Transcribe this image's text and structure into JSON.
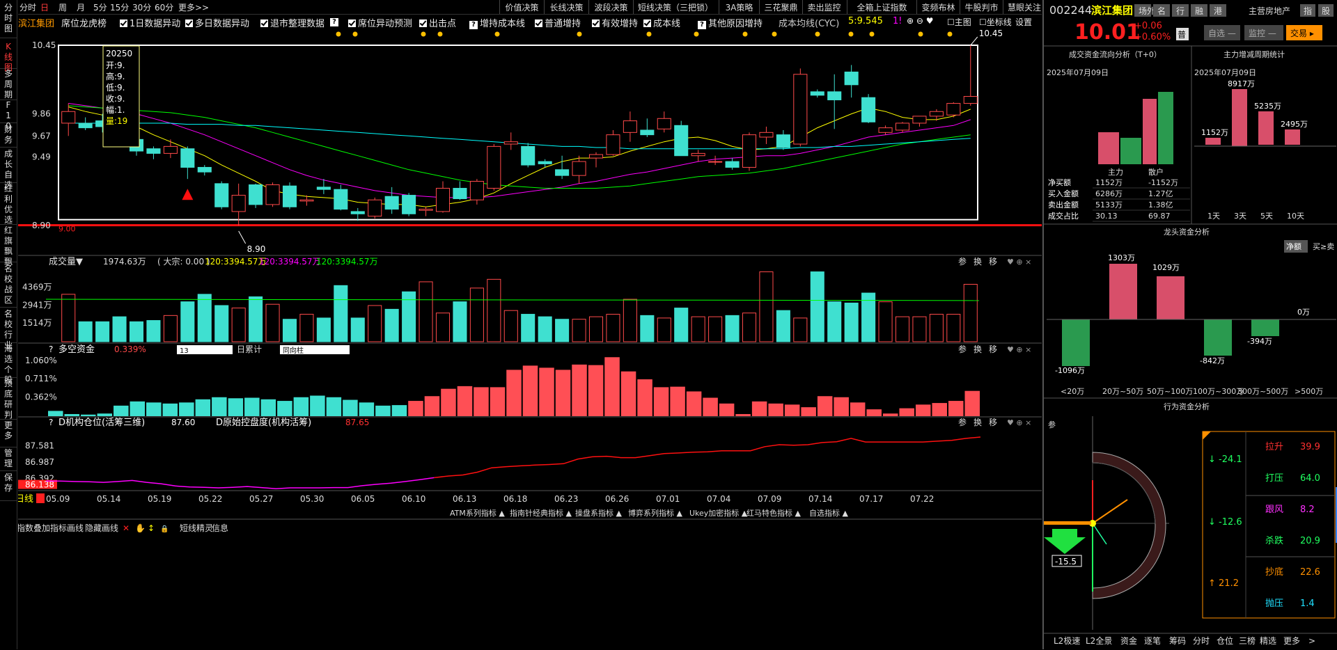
{
  "left_nav": [
    "分时图",
    "K线图",
    "多周期",
    "F10",
    "财务",
    "成长自选",
    "红利优选",
    "红旗飘飘",
    "名校战区",
    "名校行业",
    "海选个股",
    "顶底研判",
    "更多",
    "管理",
    "保存"
  ],
  "periods": [
    "分时",
    "日",
    "周",
    "月",
    "5分",
    "15分",
    "30分",
    "60分",
    "更多>>"
  ],
  "top_right_tabs": [
    "价值决策",
    "长线决策",
    "波段决策",
    "短线决策（三把锁）",
    "3A策略",
    "三花聚鼎",
    "卖出监控",
    "全箱上证指数",
    "变频布林",
    "牛股判市",
    "慧眼关注"
  ],
  "checks": {
    "dragon": "席位龙虎榜",
    "one_day": "1日数据异动",
    "multi_day": "多日数据异动",
    "delist": "退市整理数据",
    "seat_forecast": "席位异动预测",
    "sell_point": "出击点",
    "cost_line": "增持成本线",
    "normal": "普通增持",
    "effective": "有效增持",
    "cost": "成本线",
    "other": "其他原因增持"
  },
  "ma_label": "成本均线(CYC)",
  "ma_value": "5:9.545",
  "ma_value2": "1!",
  "chart_right": {
    "main": "主图",
    "axis": "坐标线",
    "settings": "设置"
  },
  "main_chart": {
    "y_labels": [
      "10.45",
      "9.86",
      "9.67",
      "9.49",
      "8.90"
    ],
    "high_label": "10.45",
    "low_label": "8.90",
    "red_line_label": "9.00",
    "tooltip": {
      "date": "20250",
      "open": "开:9.",
      "high": "高:9.",
      "low": "低:9.",
      "close": "收:9.",
      "amp": "幅:1.",
      "vol": "量:19",
      "k_open": "开",
      "k_high": "高",
      "k_low": "低",
      "k_close": "收",
      "k_amp": "幅",
      "k_vol": "量"
    }
  },
  "volume_panel": {
    "title": "成交量▼",
    "value": "1974.63万",
    "dazong": "( 大宗: 0.00 )",
    "ma1": "120:3394.57万",
    "ma2": "120:3394.57万",
    "ma3": "120:3394.57万",
    "y_labels": [
      "4369万",
      "2941万",
      "1514万"
    ]
  },
  "duokong_panel": {
    "title": "多空资金",
    "value": "0.339%",
    "select1": "13",
    "label2": "日累计",
    "select2": "同向柱",
    "y_labels": [
      "1.060%",
      "0.711%",
      "0.362%"
    ]
  },
  "jigou_panel": {
    "title": "D机构仓位(活筹三维)",
    "value": "87.60",
    "title2": "D原始控盘度(机构活筹)",
    "value2": "87.65",
    "y_labels": [
      "87.581",
      "86.987",
      "86.392",
      "86.138"
    ]
  },
  "panel_ctrls": [
    "参",
    "换",
    "移"
  ],
  "x_labels": [
    "05.09",
    "05.14",
    "05.19",
    "05.22",
    "05.27",
    "05.30",
    "06.05",
    "06.10",
    "06.13",
    "06.18",
    "06.23",
    "06.26",
    "07.01",
    "07.04",
    "07.09",
    "07.14",
    "07.17",
    "07.22"
  ],
  "x_prefix": "日线",
  "indicator_tabs": [
    "ATM系列指标",
    "指南针经典指标",
    "操盘系指标",
    "博弈系列指标",
    "Ukey加密指标",
    "红马特色指标",
    "自选指标"
  ],
  "bottom_tools": [
    "指数叠加",
    "指标",
    "画线",
    "隐藏画线",
    "短线精灵",
    "信息"
  ],
  "stock": {
    "code": "002244",
    "name": "滨江集团",
    "tags": [
      "场外",
      "名",
      "行",
      "融",
      "港"
    ],
    "industry": "主营房地产",
    "ind_tags": [
      "指",
      "股"
    ],
    "price": "10.01",
    "change": "+0.06",
    "pct": "+0.60%",
    "status": "普",
    "btn_self": "自选",
    "btn_monitor": "监控",
    "btn_trade": "交易"
  },
  "flow_title": "成交资金流向分析（T+0）",
  "period_title": "主力增减周期统计",
  "date": "2025年07月09日",
  "flow_chart": {
    "labels": [
      "主力",
      "散户"
    ],
    "rows": [
      [
        "净买额",
        "1152万",
        "-1152万"
      ],
      [
        "买入金额",
        "6286万",
        "1.27亿"
      ],
      [
        "卖出金额",
        "5133万",
        "1.38亿"
      ],
      [
        "成交占比",
        "30.13",
        "69.87"
      ]
    ]
  },
  "period_chart": {
    "values": [
      "1152万",
      "8917万",
      "5235万",
      "2495万"
    ],
    "labels": [
      "1天",
      "3天",
      "5天",
      "10天"
    ]
  },
  "dragon_title": "龙头资金分析",
  "dragon_tabs": [
    "净额",
    "买≥卖"
  ],
  "dragon_chart": {
    "values": [
      "-1096万",
      "1303万",
      "1029万",
      "-842万",
      "-394万",
      "0万"
    ],
    "labels": [
      "<20万",
      "20万~50万",
      "50万~100万",
      "100万~300万",
      "300万~500万",
      ">500万"
    ]
  },
  "behavior_title": "行为资金分析",
  "behavior_param": "参",
  "behavior": {
    "left_top": "-24.1",
    "left_mid": "-12.6",
    "left_bot": "21.2",
    "arrow_val": "-15.5",
    "items": [
      [
        "拉升",
        "39.9"
      ],
      [
        "打压",
        "64.0"
      ],
      [
        "跟风",
        "8.2"
      ],
      [
        "杀跌",
        "20.9"
      ],
      [
        "抄底",
        "22.6"
      ],
      [
        "抛压",
        "1.4"
      ]
    ]
  },
  "bottom_right": [
    "L2极速",
    "L2全景",
    "资金",
    "逐笔",
    "筹码",
    "分时",
    "仓位",
    "三榜",
    "精选",
    "更多"
  ],
  "chart_data": [
    {
      "type": "candlestick",
      "x": [
        "05.09",
        "05.14",
        "05.19",
        "05.22",
        "05.27",
        "05.30",
        "06.05",
        "06.10",
        "06.13",
        "06.18",
        "06.23",
        "06.26",
        "07.01",
        "07.04",
        "07.09",
        "07.14",
        "07.17",
        "07.22"
      ],
      "ylim": [
        8.9,
        10.45
      ],
      "candles": [
        [
          9.78,
          9.95,
          9.67,
          9.88
        ],
        [
          9.78,
          9.83,
          9.72,
          9.74
        ],
        [
          9.8,
          9.86,
          9.7,
          9.75
        ],
        [
          9.7,
          9.76,
          9.64,
          9.66
        ],
        [
          9.64,
          9.66,
          9.5,
          9.54
        ],
        [
          9.56,
          9.58,
          9.47,
          9.52
        ],
        [
          9.52,
          9.64,
          9.48,
          9.58
        ],
        [
          9.56,
          9.58,
          9.3,
          9.4
        ],
        [
          9.4,
          9.42,
          9.33,
          9.36
        ],
        [
          9.26,
          9.28,
          9.04,
          9.06
        ],
        [
          9.02,
          9.26,
          8.9,
          9.16
        ],
        [
          9.25,
          9.26,
          9.05,
          9.08
        ],
        [
          9.08,
          9.27,
          9.06,
          9.25
        ],
        [
          9.24,
          9.27,
          9.04,
          9.06
        ],
        [
          9.11,
          9.16,
          9.07,
          9.12
        ],
        [
          9.23,
          9.3,
          9.17,
          9.21
        ],
        [
          9.21,
          9.25,
          9.03,
          9.04
        ],
        [
          9.02,
          9.05,
          8.94,
          9.0
        ],
        [
          8.98,
          9.14,
          8.96,
          9.12
        ],
        [
          9.15,
          9.23,
          9.0,
          9.04
        ],
        [
          9.16,
          9.18,
          8.98,
          9.0
        ],
        [
          9.03,
          9.06,
          8.98,
          9.04
        ],
        [
          9.02,
          9.28,
          9.01,
          9.22
        ],
        [
          9.22,
          9.28,
          9.12,
          9.13
        ],
        [
          9.12,
          9.3,
          9.08,
          9.28
        ],
        [
          9.22,
          9.6,
          9.2,
          9.58
        ],
        [
          9.6,
          9.7,
          9.55,
          9.62
        ],
        [
          9.58,
          9.61,
          9.4,
          9.42
        ],
        [
          9.45,
          9.47,
          9.4,
          9.43
        ],
        [
          9.38,
          9.5,
          9.3,
          9.33
        ],
        [
          9.33,
          9.5,
          9.26,
          9.45
        ],
        [
          9.48,
          9.53,
          9.4,
          9.51
        ],
        [
          9.51,
          9.72,
          9.5,
          9.68
        ],
        [
          9.7,
          9.88,
          9.62,
          9.8
        ],
        [
          9.72,
          9.82,
          9.66,
          9.68
        ],
        [
          9.73,
          9.88,
          9.7,
          9.82
        ],
        [
          9.76,
          9.8,
          9.5,
          9.5
        ],
        [
          9.5,
          9.55,
          9.45,
          9.52
        ],
        [
          9.45,
          9.5,
          9.42,
          9.45
        ],
        [
          9.45,
          9.48,
          9.38,
          9.4
        ],
        [
          9.4,
          9.7,
          9.37,
          9.68
        ],
        [
          9.66,
          9.75,
          9.6,
          9.7
        ],
        [
          9.68,
          9.72,
          9.55,
          9.57
        ],
        [
          9.6,
          10.25,
          9.58,
          10.2
        ],
        [
          10.05,
          10.07,
          10.0,
          10.02
        ],
        [
          10.05,
          10.2,
          9.73,
          9.98
        ],
        [
          10.22,
          10.28,
          10.0,
          10.11
        ],
        [
          10.0,
          10.03,
          9.78,
          9.79
        ],
        [
          9.7,
          9.76,
          9.68,
          9.74
        ],
        [
          9.72,
          9.79,
          9.7,
          9.78
        ],
        [
          9.78,
          9.84,
          9.75,
          9.84
        ],
        [
          9.84,
          9.9,
          9.8,
          9.88
        ],
        [
          9.85,
          9.96,
          9.83,
          9.95
        ],
        [
          9.95,
          10.45,
          9.93,
          10.01
        ]
      ],
      "ma": [
        {
          "name": "5",
          "color": "#ffff00",
          "values": [
            9.92,
            9.88,
            9.85,
            9.8,
            9.75,
            9.68,
            9.62,
            9.56,
            9.5,
            9.42,
            9.35,
            9.28,
            9.2,
            9.17,
            9.15,
            9.14,
            9.13,
            9.1,
            9.09,
            9.08,
            9.08,
            9.06,
            9.08,
            9.1,
            9.13,
            9.18,
            9.26,
            9.33,
            9.4,
            9.45,
            9.48,
            9.48,
            9.49,
            9.54,
            9.58,
            9.62,
            9.65,
            9.66,
            9.63,
            9.58,
            9.55,
            9.56,
            9.58,
            9.66,
            9.74,
            9.8,
            9.86,
            9.91,
            9.88,
            9.83,
            9.81,
            9.81,
            9.84,
            9.9
          ]
        },
        {
          "name": "10",
          "color": "#ff00ff",
          "values": [
            9.95,
            9.93,
            9.91,
            9.89,
            9.86,
            9.82,
            9.78,
            9.73,
            9.68,
            9.62,
            9.56,
            9.5,
            9.44,
            9.38,
            9.33,
            9.29,
            9.26,
            9.23,
            9.2,
            9.18,
            9.16,
            9.15,
            9.14,
            9.14,
            9.14,
            9.15,
            9.17,
            9.19,
            9.21,
            9.23,
            9.26,
            9.28,
            9.31,
            9.34,
            9.36,
            9.39,
            9.42,
            9.45,
            9.47,
            9.48,
            9.49,
            9.5,
            9.5,
            9.52,
            9.55,
            9.58,
            9.62,
            9.66,
            9.68,
            9.7,
            9.72,
            9.74,
            9.76,
            9.81
          ]
        },
        {
          "name": "20",
          "color": "#00ff00",
          "values": [
            9.93,
            9.92,
            9.91,
            9.9,
            9.89,
            9.88,
            9.87,
            9.85,
            9.83,
            9.8,
            9.77,
            9.74,
            9.7,
            9.66,
            9.62,
            9.58,
            9.54,
            9.5,
            9.46,
            9.42,
            9.38,
            9.35,
            9.32,
            9.29,
            9.27,
            9.25,
            9.24,
            9.23,
            9.22,
            9.22,
            9.22,
            9.22,
            9.23,
            9.24,
            9.26,
            9.28,
            9.3,
            9.32,
            9.33,
            9.34,
            9.35,
            9.37,
            9.39,
            9.42,
            9.45,
            9.48,
            9.51,
            9.54,
            9.57,
            9.6,
            9.62,
            9.64,
            9.66,
            9.68
          ]
        },
        {
          "name": "60",
          "color": "#00ffff",
          "values": [
            9.78,
            9.78,
            9.78,
            9.78,
            9.78,
            9.78,
            9.78,
            9.77,
            9.77,
            9.77,
            9.76,
            9.76,
            9.75,
            9.74,
            9.73,
            9.72,
            9.71,
            9.7,
            9.69,
            9.68,
            9.67,
            9.66,
            9.65,
            9.64,
            9.63,
            9.62,
            9.61,
            9.6,
            9.59,
            9.58,
            9.58,
            9.57,
            9.57,
            9.56,
            9.56,
            9.56,
            9.56,
            9.56,
            9.56,
            9.56,
            9.56,
            9.56,
            9.56,
            9.57,
            9.57,
            9.58,
            9.58,
            9.59,
            9.6,
            9.61,
            9.62,
            9.63,
            9.64,
            9.65
          ]
        }
      ]
    },
    {
      "type": "bar",
      "name": "volume",
      "values": [
        3800,
        1600,
        1600,
        2000,
        1600,
        1700,
        2100,
        3200,
        3800,
        2900,
        2700,
        3600,
        3000,
        1800,
        2200,
        1900,
        4500,
        1900,
        2900,
        2600,
        4000,
        4800,
        2300,
        3200,
        4300,
        5000,
        2500,
        2200,
        2000,
        1800,
        1800,
        2000,
        2200,
        3400,
        2100,
        1900,
        2700,
        2000,
        2000,
        2100,
        2300,
        5600,
        2500,
        1900,
        5600,
        3200,
        3100,
        3900,
        3200,
        2000,
        2000,
        2200,
        2200,
        4600
      ],
      "ylim": [
        0,
        5800
      ]
    },
    {
      "type": "bar",
      "name": "duokong",
      "values": [
        0.1,
        0.04,
        0.03,
        0.05,
        0.2,
        0.28,
        0.26,
        0.24,
        0.26,
        0.32,
        0.36,
        0.34,
        0.35,
        0.32,
        0.29,
        0.36,
        0.39,
        0.36,
        0.31,
        0.26,
        0.2,
        0.21,
        0.29,
        0.38,
        0.52,
        0.57,
        0.55,
        0.55,
        0.88,
        0.96,
        0.92,
        0.88,
        0.98,
        0.97,
        1.12,
        0.85,
        0.7,
        0.55,
        0.56,
        0.47,
        0.35,
        0.24,
        0.04,
        0.28,
        0.24,
        0.22,
        0.17,
        0.38,
        0.36,
        0.26,
        0.13,
        0.05,
        0.15,
        0.22,
        0.25,
        0.29,
        0.48
      ],
      "signs": [
        -1,
        -1,
        -1,
        -1,
        -1,
        -1,
        -1,
        -1,
        -1,
        -1,
        -1,
        -1,
        -1,
        -1,
        -1,
        -1,
        -1,
        -1,
        -1,
        -1,
        -1,
        -1,
        1,
        1,
        1,
        1,
        1,
        1,
        1,
        1,
        1,
        1,
        1,
        1,
        1,
        1,
        1,
        1,
        1,
        1,
        1,
        1,
        1,
        1,
        1,
        1,
        1,
        1,
        1,
        1,
        1,
        1,
        1,
        1,
        1,
        1,
        1
      ],
      "ylim": [
        0,
        1.15
      ]
    },
    {
      "type": "line",
      "name": "jigou",
      "values": [
        86.3,
        86.3,
        86.28,
        86.27,
        86.25,
        86.28,
        86.32,
        86.25,
        86.2,
        86.12,
        86.08,
        86.07,
        86.05,
        86.07,
        86.1,
        86.06,
        86.02,
        86.05,
        86.05,
        86.05,
        86.06,
        86.06,
        86.13,
        86.18,
        86.22,
        86.28,
        86.35,
        86.42,
        86.48,
        86.52,
        86.62,
        86.78,
        86.82,
        86.85,
        86.88,
        86.9,
        86.93,
        87.1,
        87.18,
        87.2,
        87.15,
        87.15,
        87.22,
        87.3,
        87.32,
        87.35,
        87.36,
        87.4,
        87.4,
        87.4,
        87.55,
        87.62,
        87.6,
        87.62,
        87.7,
        87.73,
        87.85,
        87.72,
        87.72,
        87.72,
        87.72,
        87.72,
        87.75,
        87.78,
        87.85,
        87.9
      ],
      "ylim": [
        86.0,
        87.95
      ],
      "split": 27
    }
  ]
}
